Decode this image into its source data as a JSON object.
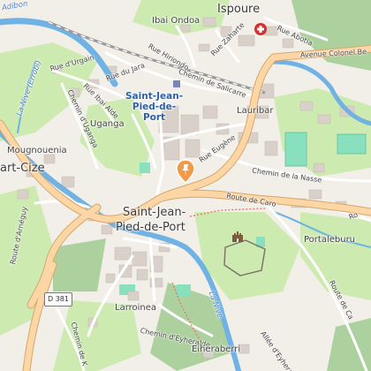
{
  "colors": {
    "background": "#f2efe9",
    "park": "#cdebb0",
    "forest": "#add19e",
    "pitch": "#88e0be",
    "built": "#d9d0c9",
    "water": "#6fb2e3",
    "road_major": "#fcd6a4",
    "road_major_casing": "#d9a66a",
    "road_minor": "#ffffff",
    "railway": "#999999",
    "marker": "#f39a47",
    "hospital": "#d32f2f"
  },
  "labels": {
    "ispoure": "Ispoure",
    "ibai_ondoa": "Ibai Ondoa",
    "adibon": "Adibon",
    "rue_abotia": "Rue Abotia",
    "rue_zaharte": "Rue Zaharte",
    "rue_colonel": "Avenue Colonel Be",
    "rue_hiriondo": "Rue Hiriondo",
    "rue_urgain": "Rue d'Urgain",
    "rue_jara": "Rue du Jara",
    "chemin_salicarre": "Chemin de Salicarre",
    "rue_ibai_alde": "Rue Ibai Alde",
    "nive_errobi": "La Nive (Errobi)",
    "chemin_uganga": "Chemin d'Uganga",
    "town_main": "Saint-Jean-\nPied-de-\nPort",
    "uganga": "Uganga",
    "lauribar": "Lauribar",
    "mougnouenia": "Mougnouenia",
    "art_cize": "art-Cize",
    "rue_eugene": "Rue Eugène",
    "chemin_nasse": "Chemin de la Nasse",
    "route_caro": "Route de Caro",
    "town_big_1": "Saint-Jean-",
    "town_big_2": "Pied-de-Port",
    "portaleburu": "Portaleburu",
    "route_arneguy": "Route d'Arnéguy",
    "d381": "D 381",
    "larroinea": "Larroinea",
    "la_nive": "La Nive",
    "chemin_eyheralde": "Chemin d'Eyheralde",
    "chemin_k": "Chemin de K",
    "eiheraberri": "Eiheraberri",
    "route_ca": "Route de Ca",
    "allee_ecole": "Allée d'Eyheralde",
    "ro": "Ro"
  },
  "icons": {
    "hospital": "hospital-icon",
    "castle": "castle-icon",
    "marker": "location-pin-icon"
  }
}
